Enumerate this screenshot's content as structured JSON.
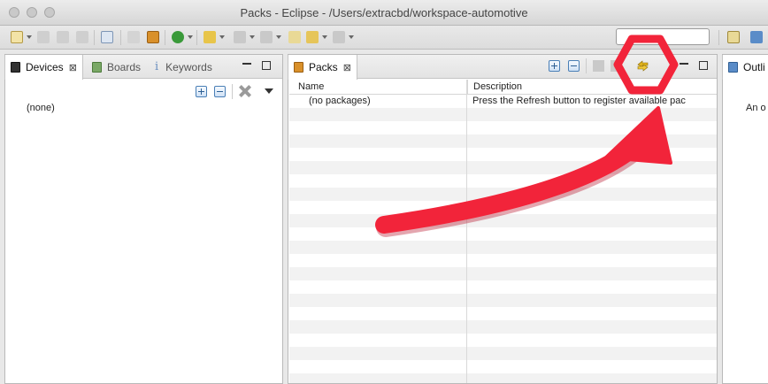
{
  "window": {
    "title": "Packs - Eclipse - /Users/extracbd/workspace-automotive"
  },
  "toolbar": {
    "search_value": ""
  },
  "left_panel": {
    "tabs": [
      {
        "label": "Devices",
        "close": "⊠"
      },
      {
        "label": "Boards"
      },
      {
        "label": "Keywords",
        "icon_glyph": "i"
      }
    ],
    "content_text": "(none)"
  },
  "packs_panel": {
    "tab_label": "Packs",
    "tab_close": "⊠",
    "columns": [
      "Name",
      "Description"
    ],
    "rows": [
      {
        "name": "(no packages)",
        "description": "Press the Refresh button to register available pac"
      }
    ]
  },
  "outline_panel": {
    "tab_label": "Outli",
    "content_text": "An o"
  },
  "colors": {
    "annotation_red": "#f2243a"
  },
  "icons": {
    "refresh": "refresh-icon",
    "close": "close-icon"
  }
}
